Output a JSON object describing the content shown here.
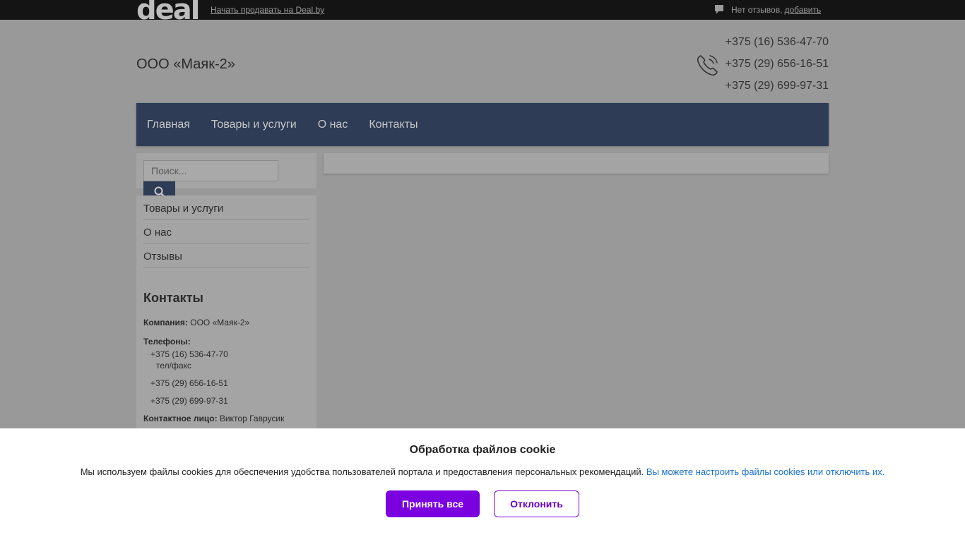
{
  "topbar": {
    "logo_text": "deal",
    "sell_link": "Начать продавать на Deal.by",
    "reviews_text": "Нет отзывов,",
    "reviews_add": "добавить",
    "icon": "comment-icon"
  },
  "header": {
    "company_name": "ООО «Маяк-2»",
    "phone_icon": "phone-icon",
    "phones": [
      "+375 (16) 536-47-70",
      "+375 (29) 656-16-51",
      "+375 (29) 699-97-31"
    ]
  },
  "nav": {
    "items": [
      {
        "label": "Главная"
      },
      {
        "label": "Товары и услуги"
      },
      {
        "label": "О нас"
      },
      {
        "label": "Контакты"
      }
    ]
  },
  "search": {
    "placeholder": "Поиск...",
    "icon": "search-icon"
  },
  "sidebar": {
    "menu": [
      {
        "label": "Товары и услуги"
      },
      {
        "label": "О нас"
      },
      {
        "label": "Отзывы"
      }
    ],
    "contacts_title": "Контакты",
    "company_label": "Компания:",
    "company_value": "ООО «Маяк-2»",
    "phones_label": "Телефоны:",
    "phones": [
      {
        "number": "+375 (16) 536-47-70",
        "note": "тел/факс"
      },
      {
        "number": "+375 (29) 656-16-51"
      },
      {
        "number": "+375 (29) 699-97-31"
      }
    ],
    "contact_person_label": "Контактное лицо:",
    "contact_person_value": "Виктор Гаврусик"
  },
  "cookie": {
    "title": "Обработка файлов cookie",
    "text": "Мы используем файлы cookies для обеспечения удобства пользователей портала и предоставления персональных рекомендаций.",
    "link": "Вы можете настроить файлы cookies или отключить их.",
    "accept": "Принять все",
    "decline": "Отклонить"
  },
  "colors": {
    "nav_bg": "#2e3c56",
    "accent_purple": "#7b00e0",
    "link_blue": "#1a6fd1",
    "overlay_gray": "#999999"
  }
}
